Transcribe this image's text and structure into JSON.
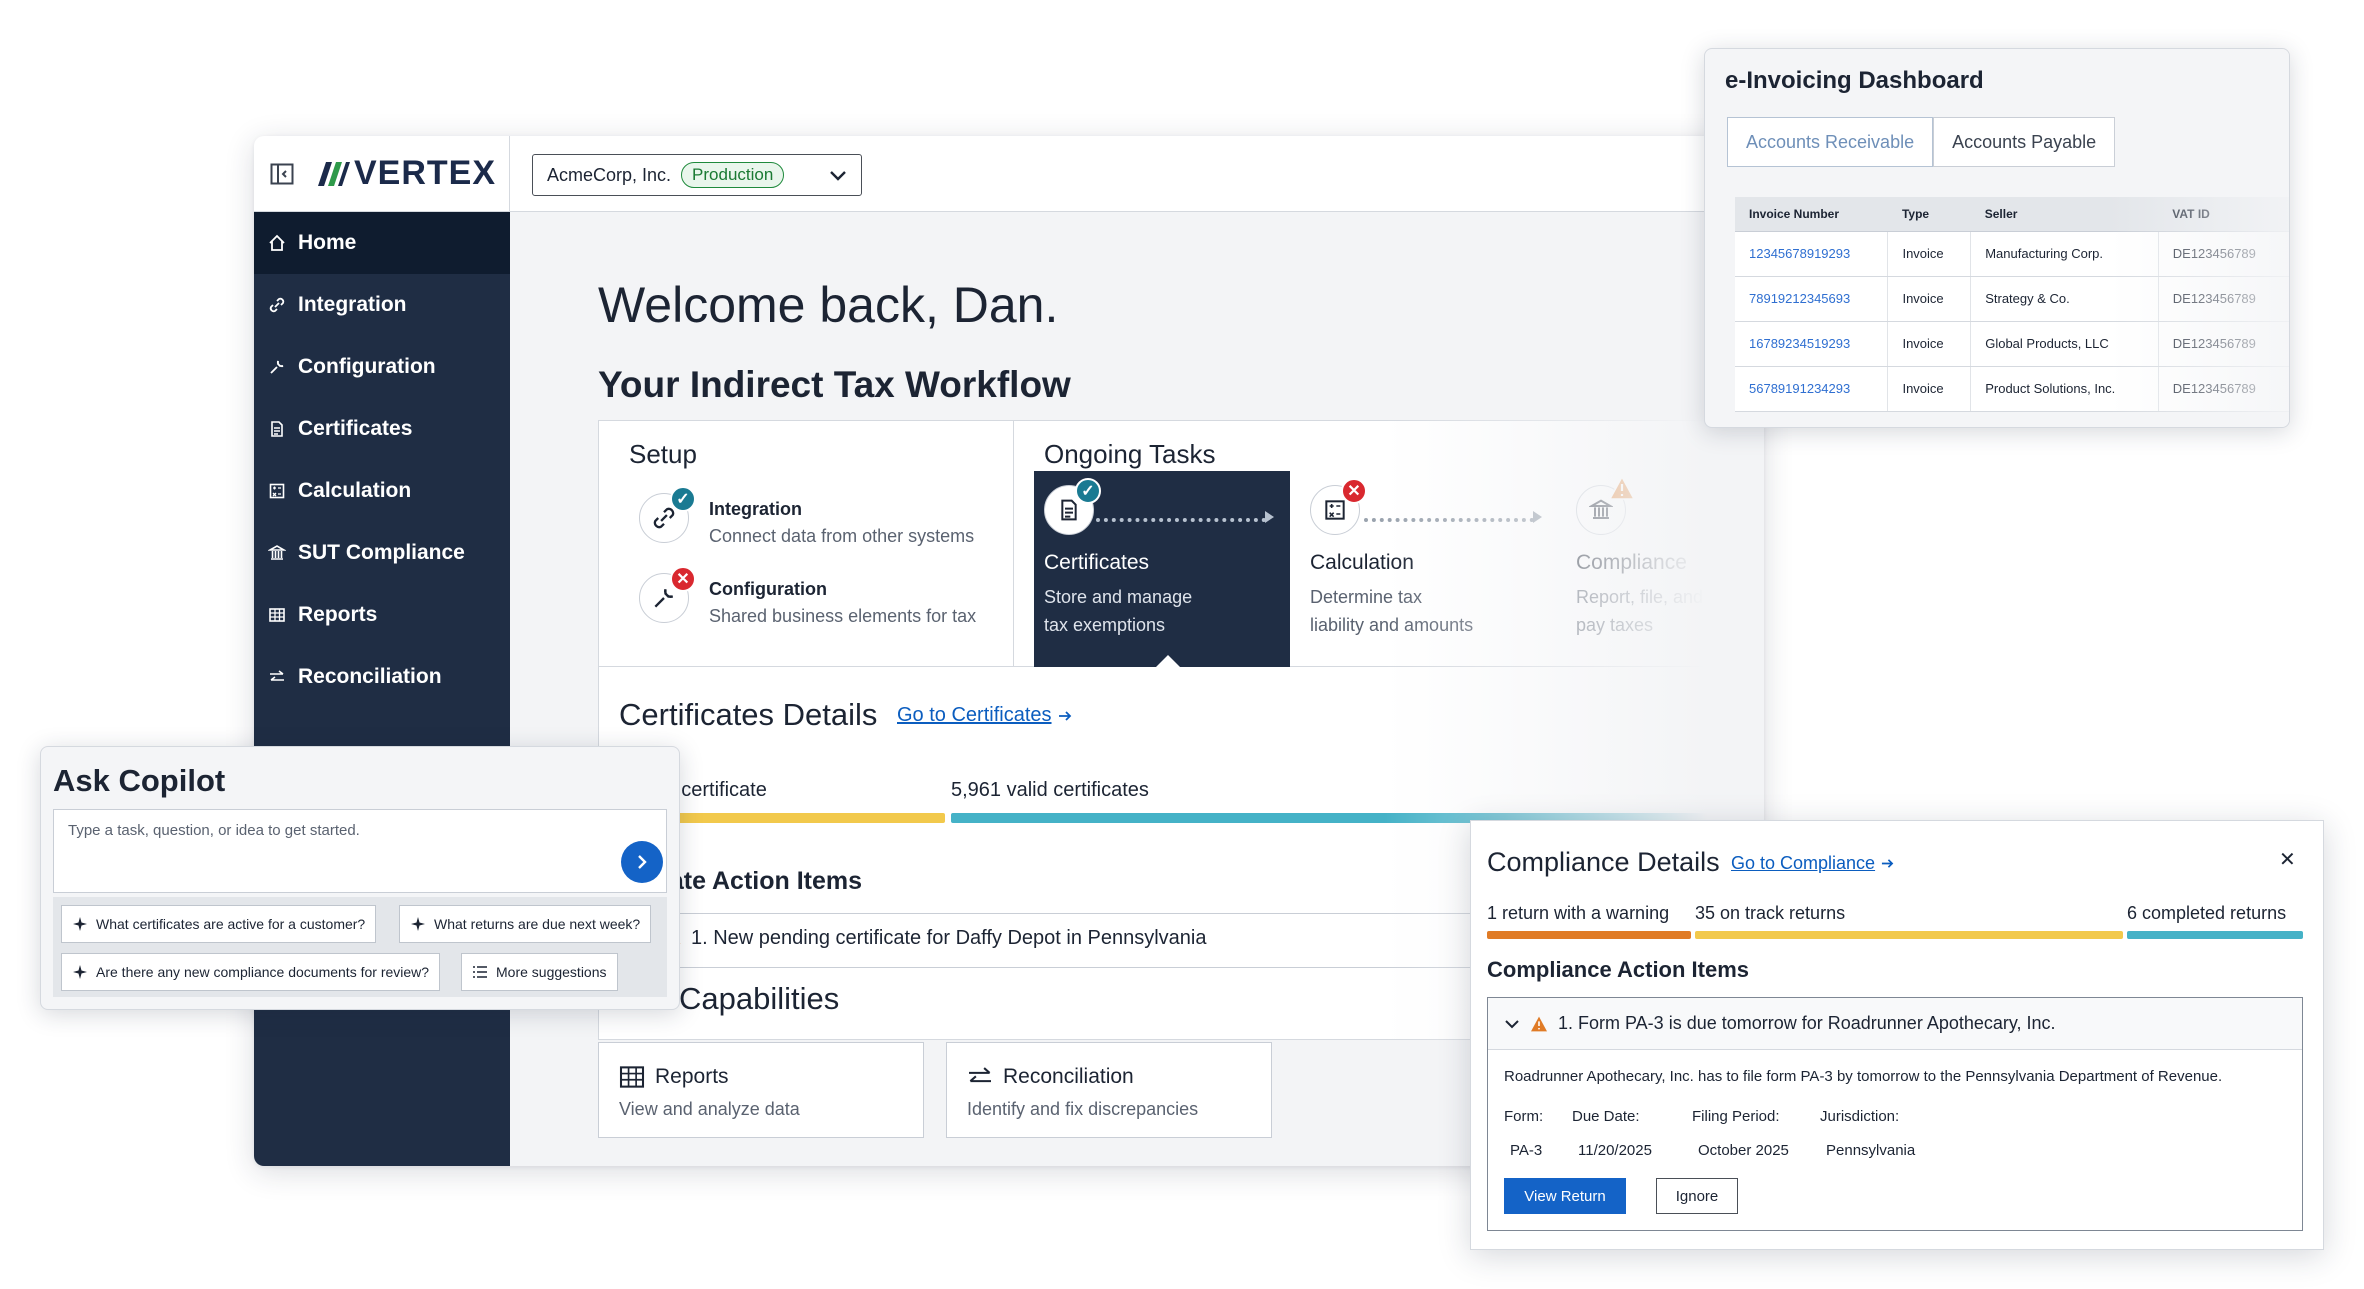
{
  "header": {
    "logo_text": "VERTEX",
    "org_name": "AcmeCorp, Inc.",
    "env_badge": "Production"
  },
  "sidebar": {
    "items": [
      {
        "label": "Home",
        "icon": "home-icon",
        "active": true
      },
      {
        "label": "Integration",
        "icon": "link-icon"
      },
      {
        "label": "Configuration",
        "icon": "wrench-icon"
      },
      {
        "label": "Certificates",
        "icon": "document-icon"
      },
      {
        "label": "Calculation",
        "icon": "calculator-icon"
      },
      {
        "label": "SUT Compliance",
        "icon": "bank-icon"
      },
      {
        "label": "Reports",
        "icon": "table-icon"
      },
      {
        "label": "Reconciliation",
        "icon": "arrows-icon"
      }
    ]
  },
  "main": {
    "welcome": "Welcome back, Dan.",
    "workflow_title": "Your Indirect Tax Workflow",
    "setup": {
      "title": "Setup",
      "items": [
        {
          "title": "Integration",
          "subtitle": "Connect data from other systems",
          "status": "done"
        },
        {
          "title": "Configuration",
          "subtitle": "Shared business elements for tax",
          "status": "error"
        }
      ]
    },
    "ongoing": {
      "title": "Ongoing Tasks",
      "tasks": [
        {
          "title": "Certificates",
          "subtitle_1": "Store and manage",
          "subtitle_2": "tax exemptions",
          "status": "done"
        },
        {
          "title": "Calculation",
          "subtitle_1": "Determine tax",
          "subtitle_2": "liability and amounts",
          "status": "error"
        },
        {
          "title": "Compliance",
          "subtitle_1": "Report, file, and",
          "subtitle_2": "pay taxes",
          "status": "warning"
        }
      ]
    },
    "cert_details": {
      "title": "Certificates Details",
      "link": "Go to Certificates",
      "pending_label": "ing certificate",
      "valid_label": "5,961 valid certificates",
      "action_title": "icate Action Items",
      "action_item": "1.  New pending certificate for Daffy Depot in Pennsylvania"
    },
    "capabilities": {
      "title": "Capabilities",
      "cards": [
        {
          "title": "Reports",
          "subtitle": "View and analyze data"
        },
        {
          "title": "Reconciliation",
          "subtitle": "Identify and fix discrepancies"
        }
      ]
    }
  },
  "einvoicing": {
    "title": "e-Invoicing Dashboard",
    "tabs": [
      "Accounts Receivable",
      "Accounts Payable"
    ],
    "columns": [
      "Invoice Number",
      "Type",
      "Seller",
      "VAT ID"
    ],
    "rows": [
      [
        "12345678919293",
        "Invoice",
        "Manufacturing Corp.",
        "DE123456789"
      ],
      [
        "78919212345693",
        "Invoice",
        "Strategy & Co.",
        "DE123456789"
      ],
      [
        "16789234519293",
        "Invoice",
        "Global Products, LLC",
        "DE123456789"
      ],
      [
        "56789191234293",
        "Invoice",
        "Product Solutions, Inc.",
        "DE123456789"
      ]
    ]
  },
  "copilot": {
    "title": "Ask Copilot",
    "placeholder": "Type a task, question, or idea to get started.",
    "chips": [
      "What certificates are active for a customer?",
      "What returns are due next week?",
      "Are there any new compliance documents for review?",
      "More suggestions"
    ]
  },
  "compliance": {
    "title": "Compliance Details",
    "link": "Go to Compliance",
    "warning_label": "1 return with a warning",
    "ontrack_label": "35 on track returns",
    "completed_label": "6 completed returns",
    "action_title": "Compliance Action Items",
    "item_title": "1. Form PA-3 is due tomorrow for Roadrunner Apothecary, Inc.",
    "description": "Roadrunner Apothecary, Inc. has to file form PA-3 by tomorrow to the Pennsylvania Department of Revenue.",
    "fields": [
      {
        "label": "Form:",
        "value": "PA-3"
      },
      {
        "label": "Due Date:",
        "value": "11/20/2025"
      },
      {
        "label": "Filing Period:",
        "value": "October 2025"
      },
      {
        "label": "Jurisdiction:",
        "value": "Pennsylvania"
      }
    ],
    "primary_button": "View Return",
    "secondary_button": "Ignore"
  },
  "colors": {
    "navy": "#1f2d44",
    "accent_blue": "#1463c7",
    "teal": "#45b2c7",
    "yellow": "#f2c94c",
    "orange": "#e07b26",
    "error_red": "#d9282f"
  }
}
